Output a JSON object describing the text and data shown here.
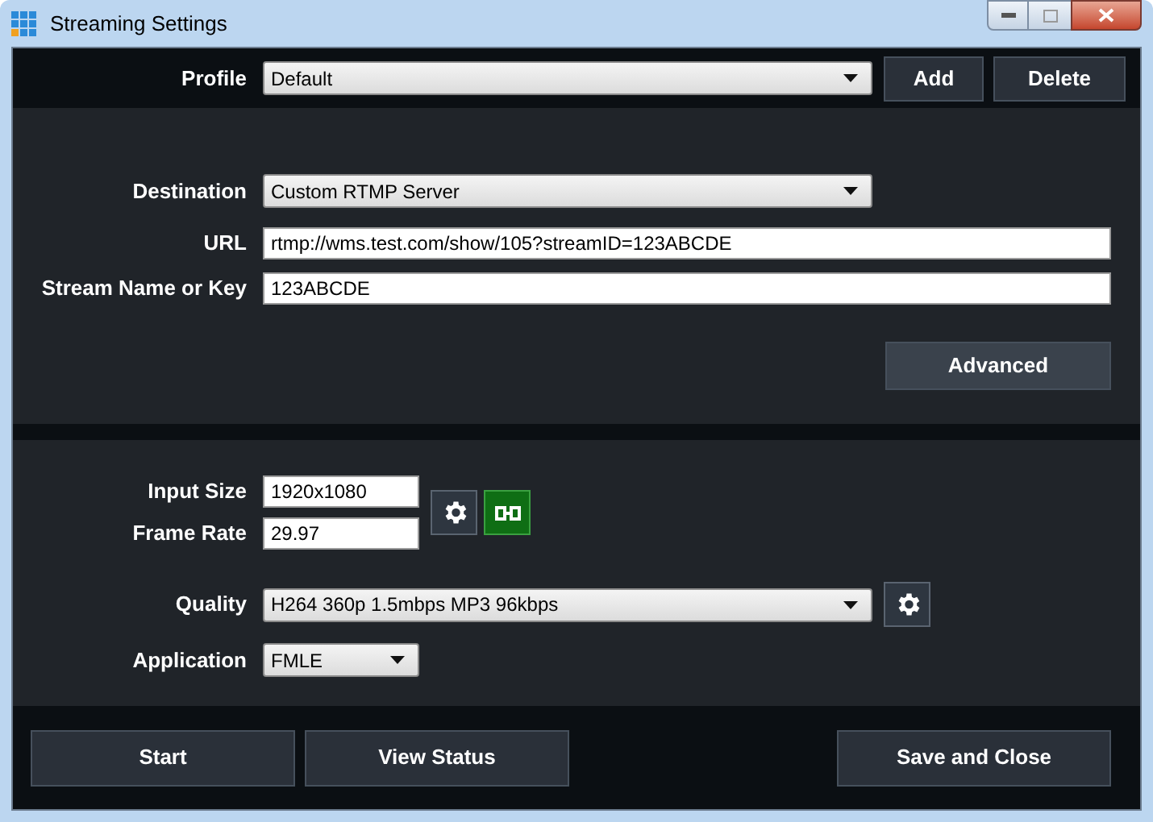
{
  "window": {
    "title": "Streaming Settings"
  },
  "profile": {
    "label": "Profile",
    "value": "Default",
    "buttons": [
      "Add",
      "Delete"
    ]
  },
  "destination": {
    "label": "Destination",
    "value": "Custom RTMP Server"
  },
  "url": {
    "label": "URL",
    "value": "rtmp://wms.test.com/show/105?streamID=123ABCDE"
  },
  "stream_key": {
    "label": "Stream Name or Key",
    "value": "123ABCDE"
  },
  "advanced_button": "Advanced",
  "input_size": {
    "label": "Input Size",
    "value": "1920x1080"
  },
  "frame_rate": {
    "label": "Frame Rate",
    "value": "29.97"
  },
  "quality": {
    "label": "Quality",
    "value": "H264 360p 1.5mbps MP3 96kbps"
  },
  "application": {
    "label": "Application",
    "value": "FMLE"
  },
  "footer": {
    "left_buttons": [
      "Start",
      "View Status"
    ],
    "right_button": "Save and Close"
  }
}
